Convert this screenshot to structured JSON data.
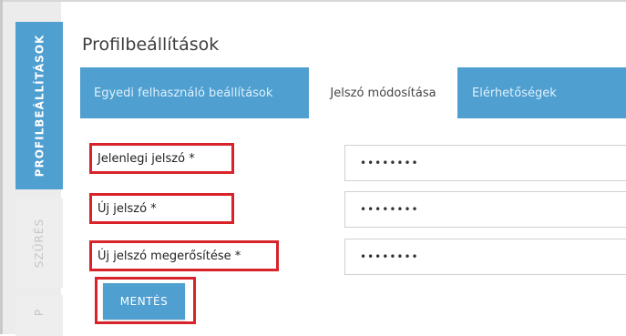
{
  "sidebar": {
    "tabs": [
      {
        "label": "PROFILBEÁLLÍTÁSOK",
        "active": true
      },
      {
        "label": "SZŰRÉS",
        "active": false
      },
      {
        "label": "P",
        "active": false
      }
    ]
  },
  "page": {
    "title": "Profilbeállítások"
  },
  "tabs": [
    {
      "label": "Egyedi felhasználó beállítások",
      "active": false
    },
    {
      "label": "Jelszó módosítása",
      "active": true
    },
    {
      "label": "Elérhetőségek",
      "active": false
    }
  ],
  "form": {
    "fields": [
      {
        "label": "Jelenlegi jelszó *",
        "value": "••••••••"
      },
      {
        "label": "Új jelszó *",
        "value": "••••••••"
      },
      {
        "label": "Új jelszó megerősítése *",
        "value": "••••••••"
      }
    ],
    "save_label": "MENTÉS"
  },
  "colors": {
    "accent": "#4f9fd0",
    "highlight": "#d8232a"
  }
}
